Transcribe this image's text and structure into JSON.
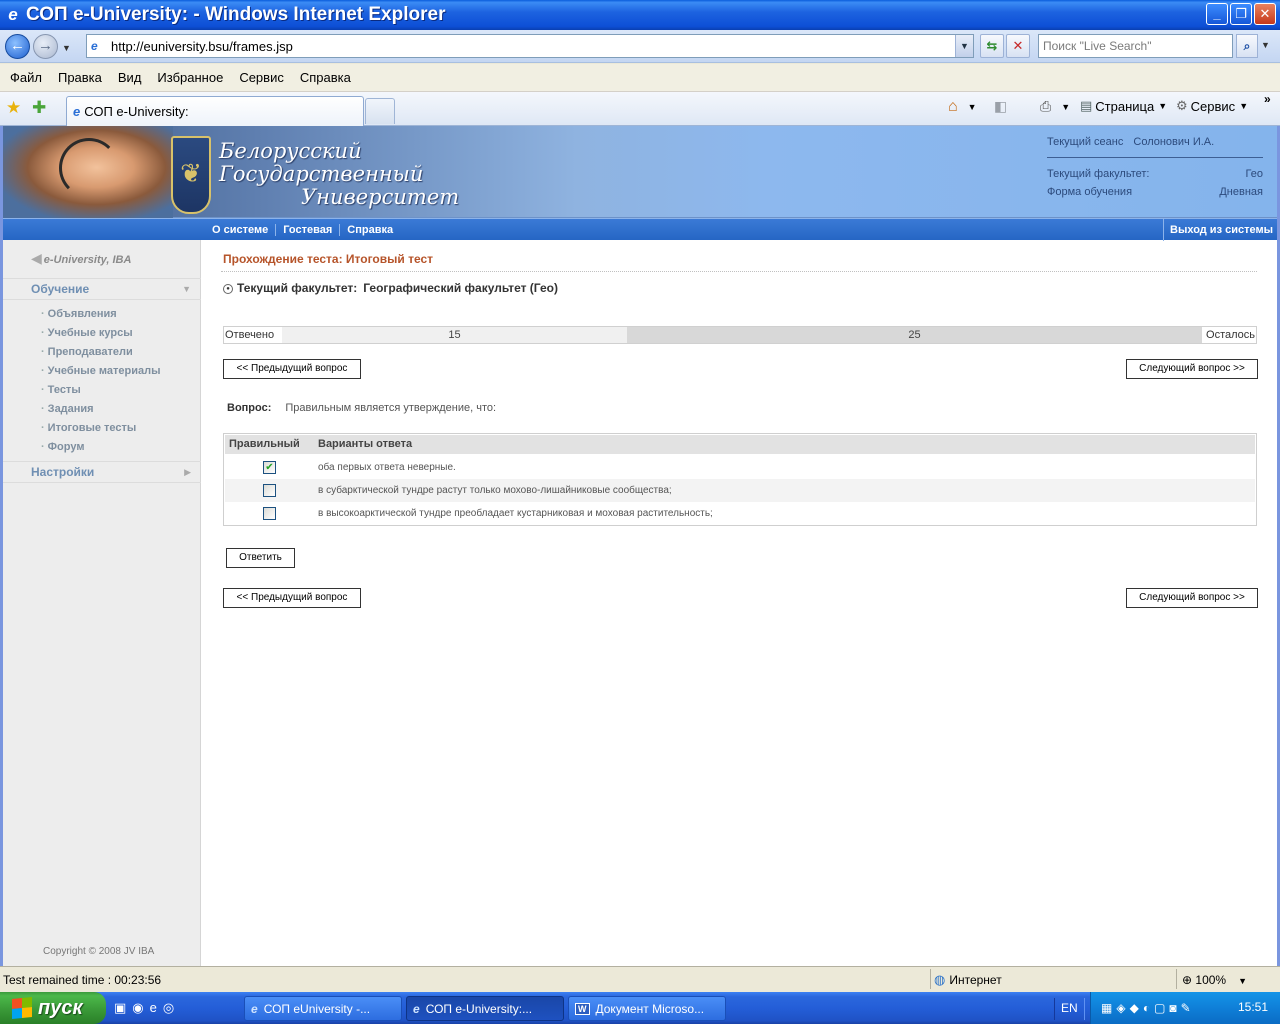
{
  "window": {
    "title": "СОП e-University:  - Windows Internet Explorer"
  },
  "address": {
    "url": "http://euniversity.bsu/frames.jsp"
  },
  "search": {
    "placeholder": "Поиск \"Live Search\""
  },
  "menu": [
    "Файл",
    "Правка",
    "Вид",
    "Избранное",
    "Сервис",
    "Справка"
  ],
  "tab": {
    "label": "СОП e-University:"
  },
  "commandbar": {
    "page_label": "Страница",
    "service_label": "Сервис"
  },
  "banner": {
    "line1": "Белорусский",
    "line2": "Государственный",
    "line3": "Университет",
    "session_label": "Текущий сеанс",
    "session_user": "Солонович И.А.",
    "faculty_label": "Текущий факультет:",
    "faculty_value": "Гео",
    "study_form_label": "Форма обучения",
    "study_form_value": "Дневная"
  },
  "topnav": {
    "links": [
      "О системе",
      "Гостевая",
      "Справка"
    ],
    "exit": "Выход из системы"
  },
  "sidebar": {
    "brand": "e-University, IBA",
    "section_learning": "Обучение",
    "items": [
      "Объявления",
      "Учебные курсы",
      "Преподаватели",
      "Учебные материалы",
      "Тесты",
      "Задания",
      "Итоговые тесты",
      "Форум"
    ],
    "section_settings": "Настройки",
    "copyright": "Copyright © 2008 JV IBA"
  },
  "main": {
    "heading": "Прохождение теста: Итоговый тест",
    "faculty_label": "Текущий факультет:",
    "faculty_value": "Географический факультет (Гео)",
    "progress": {
      "left_label": "Отвечено",
      "answered": 15,
      "remaining": 25,
      "right_label": "Осталось"
    },
    "prev_button": "<< Предыдущий вопрос",
    "next_button": "Следующий вопрос >>",
    "question_label": "Вопрос:",
    "question_text": "Правильным является утверждение, что:",
    "table": {
      "col_correct": "Правильный",
      "col_options": "Варианты ответа",
      "rows": [
        {
          "text": "оба первых ответа неверные.",
          "checked": true
        },
        {
          "text": "в субарктической тундре растут только мохово-лишайниковые сообщества;",
          "checked": false
        },
        {
          "text": "в высокоарктической тундре преобладает кустарниковая и моховая растительность;",
          "checked": false
        }
      ]
    },
    "answer_button": "Ответить"
  },
  "statusbar": {
    "left": "Test remained time :  00:23:56",
    "zone": "Интернет",
    "zoom": "100%"
  },
  "taskbar": {
    "start": "пуск",
    "items": [
      "СОП eUniversity -...",
      "СОП e-University:...",
      "Документ Microso..."
    ],
    "lang": "EN",
    "clock": "15:51"
  }
}
